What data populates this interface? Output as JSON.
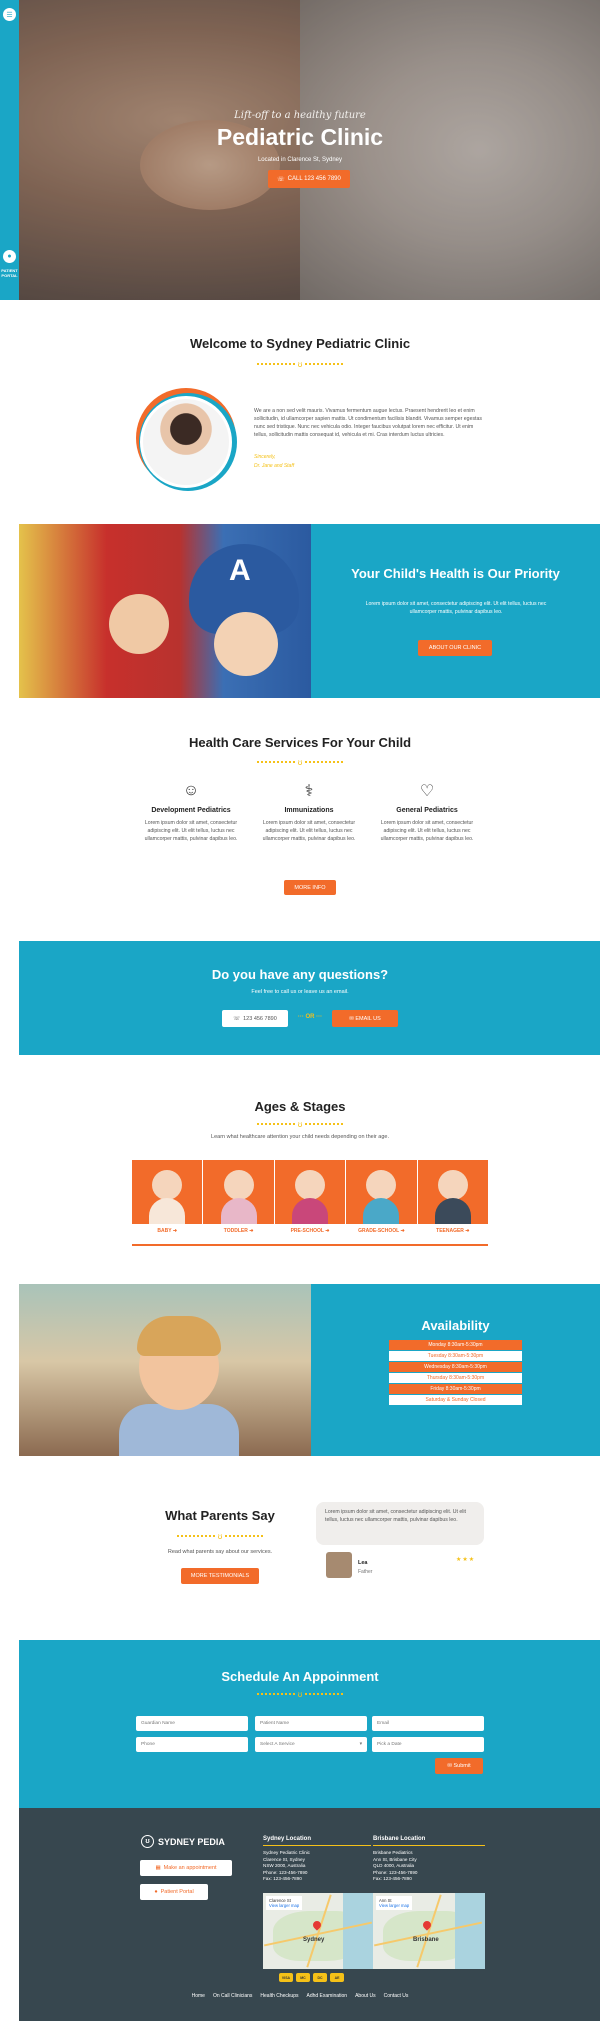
{
  "sidebar": {
    "portal_label": "PATIENT PORTAL",
    "menu_icon": "menu-icon",
    "portal_icon": "user-icon"
  },
  "hero": {
    "tagline": "Lift-off to a healthy future",
    "title": "Pediatric Clinic",
    "subtitle": "Located in Clarence St, Sydney",
    "call_label": "CALL 123 456 7890"
  },
  "welcome": {
    "title": "Welcome to Sydney Pediatric Clinic",
    "body": "We are a non sed velit mauris. Vivamus fermentum augue lectus. Praesent hendrerit leo et enim sollicitudin, id ullamcorper sapien mattis. Ut condimentum facilisis blandit. Vivamus semper egestas nunc sed tristique. Nunc nec vehicula odio. Integer faucibus volutpat lorem nec efficitur. Ut enim tellus, sollicitudin mattis consequat id, vehicula et mi. Cras interdum luctus ultricies.",
    "sign_line1": "Sincerely,",
    "sign_line2": "Dr. Jane and Staff"
  },
  "priority": {
    "title": "Your Child's Health is Our Priority",
    "body": "Lorem ipsum dolor sit amet, consectetur adipiscing elit. Ut elit tellus, luctus nec ullamcorper mattis, pulvinar dapibus leo.",
    "button": "ABOUT OUR CLINIC"
  },
  "services": {
    "title": "Health Care Services For Your Child",
    "items": [
      {
        "title": "Development Pediatrics",
        "icon": "baby-face-icon",
        "body": "Lorem ipsum dolor sit amet, consectetur adipiscing elit. Ut elit tellus, luctus nec ullamcorper mattis, pulvinar dapibus leo."
      },
      {
        "title": "Immunizations",
        "icon": "syringe-icon",
        "body": "Lorem ipsum dolor sit amet, consectetur adipiscing elit. Ut elit tellus, luctus nec ullamcorper mattis, pulvinar dapibus leo."
      },
      {
        "title": "General Pediatrics",
        "icon": "heart-plus-icon",
        "body": "Lorem ipsum dolor sit amet, consectetur adipiscing elit. Ut elit tellus, luctus nec ullamcorper mattis, pulvinar dapibus leo."
      }
    ],
    "button": "MORE INFO"
  },
  "questions": {
    "title": "Do you have any questions?",
    "subtitle": "Feel free to call us or leave us an email.",
    "phone": "123 456 7890",
    "or": "OR",
    "email": "EMAIL US"
  },
  "ages": {
    "title": "Ages & Stages",
    "subtitle": "Learn what healthcare attention your child needs depending on their age.",
    "items": [
      {
        "label": "BABY",
        "color": "#f5d5bc",
        "body": "#f7e7d9"
      },
      {
        "label": "TODDLER",
        "color": "#f5d5bc",
        "body": "#e8b7c8"
      },
      {
        "label": "PRE-SCHOOL",
        "color": "#f5d5bc",
        "body": "#c9477a"
      },
      {
        "label": "GRADE-SCHOOL",
        "color": "#f5d5bc",
        "body": "#4aa8c8"
      },
      {
        "label": "TEENAGER",
        "color": "#f5d5bc",
        "body": "#3b4a5a"
      }
    ]
  },
  "availability": {
    "title": "Availability",
    "rows": [
      {
        "text": "Monday 8:30am-5:30pm",
        "bg": "#f26b2a",
        "fg": "#ffffff"
      },
      {
        "text": "Tuesday 8:30am-5:30pm",
        "bg": "#ffffff",
        "fg": "#f26b2a"
      },
      {
        "text": "Wednesday 8:30am-5:30pm",
        "bg": "#f26b2a",
        "fg": "#ffffff"
      },
      {
        "text": "Thursday 8:30am-5:30pm",
        "bg": "#ffffff",
        "fg": "#f26b2a"
      },
      {
        "text": "Friday 8:30am-5:30pm",
        "bg": "#f26b2a",
        "fg": "#ffffff"
      },
      {
        "text": "Saturday & Sunday Closed",
        "bg": "#ffffff",
        "fg": "#f26b2a"
      }
    ]
  },
  "parents": {
    "title": "What Parents Say",
    "subtitle": "Read what parents say about our services.",
    "button": "MORE TESTIMONIALS",
    "quote": "Lorem ipsum dolor sit amet, consectetur adipiscing elit. Ut elit tellus, luctus nec ullamcorper mattis, pulvinar dapibus leo.",
    "name": "Lea",
    "role": "Father",
    "stars": "★★★"
  },
  "schedule": {
    "title": "Schedule An Appoinment",
    "fields": {
      "guardian": "Guardian Name",
      "patient": "Patient Name",
      "email": "Email",
      "phone": "Phone",
      "service": "Select A Service",
      "date": "Pick a Date"
    },
    "submit": "Submit"
  },
  "footer": {
    "logo": "SYDNEY PEDIA",
    "appointment": "Make an appointment",
    "portal": "Patient Portal",
    "sydney": {
      "title": "Sydney Location",
      "lines": [
        "Sydney Pediatric Clinic",
        "Clarence St, Sydney",
        "NSW 2000, Australia",
        "Phone: 123-456-7890",
        "Fax: 123-456-7890"
      ],
      "map_label": "Clarence St",
      "map_link": "View larger map",
      "city": "Sydney"
    },
    "brisbane": {
      "title": "Brisbane Location",
      "lines": [
        "Brisbane Pediatrics",
        "Ann St, Brisbane City",
        "QLD 4000, Australia",
        "Phone: 123-456-7890",
        "Fax: 123-456-7890"
      ],
      "map_label": "Ann St",
      "map_link": "View larger map",
      "city": "Brisbane"
    },
    "payments": [
      "VISA",
      "MC",
      "DC",
      "AE"
    ],
    "nav": [
      "Home",
      "On Call Clinicians",
      "Health Checkups",
      "Adhd Examination",
      "About Us",
      "Contact Us"
    ]
  },
  "colors": {
    "teal": "#1aa6c6",
    "orange": "#f26b2a",
    "yellow": "#f5c118",
    "footer": "#37474f"
  }
}
